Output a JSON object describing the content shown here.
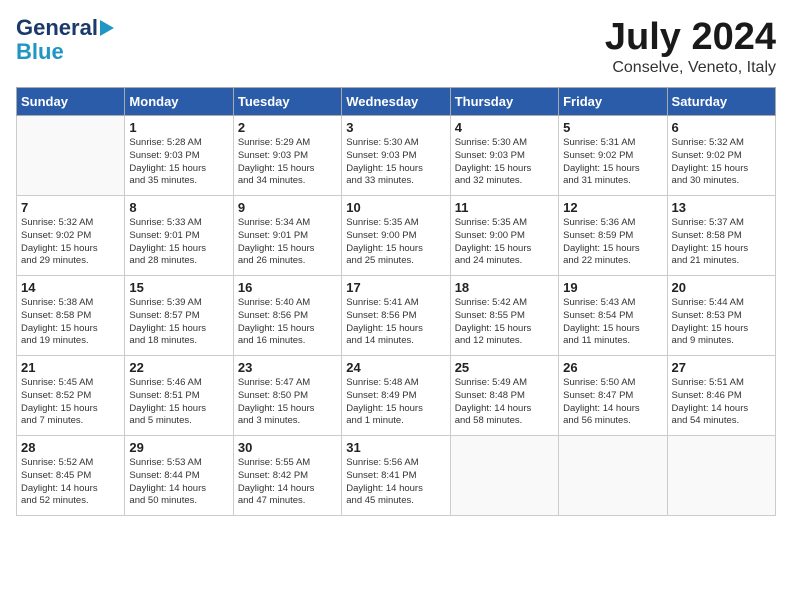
{
  "logo": {
    "line1": "General",
    "line2": "Blue"
  },
  "title": "July 2024",
  "subtitle": "Conselve, Veneto, Italy",
  "days": [
    "Sunday",
    "Monday",
    "Tuesday",
    "Wednesday",
    "Thursday",
    "Friday",
    "Saturday"
  ],
  "weeks": [
    [
      {
        "num": "",
        "info": ""
      },
      {
        "num": "1",
        "info": "Sunrise: 5:28 AM\nSunset: 9:03 PM\nDaylight: 15 hours\nand 35 minutes."
      },
      {
        "num": "2",
        "info": "Sunrise: 5:29 AM\nSunset: 9:03 PM\nDaylight: 15 hours\nand 34 minutes."
      },
      {
        "num": "3",
        "info": "Sunrise: 5:30 AM\nSunset: 9:03 PM\nDaylight: 15 hours\nand 33 minutes."
      },
      {
        "num": "4",
        "info": "Sunrise: 5:30 AM\nSunset: 9:03 PM\nDaylight: 15 hours\nand 32 minutes."
      },
      {
        "num": "5",
        "info": "Sunrise: 5:31 AM\nSunset: 9:02 PM\nDaylight: 15 hours\nand 31 minutes."
      },
      {
        "num": "6",
        "info": "Sunrise: 5:32 AM\nSunset: 9:02 PM\nDaylight: 15 hours\nand 30 minutes."
      }
    ],
    [
      {
        "num": "7",
        "info": "Sunrise: 5:32 AM\nSunset: 9:02 PM\nDaylight: 15 hours\nand 29 minutes."
      },
      {
        "num": "8",
        "info": "Sunrise: 5:33 AM\nSunset: 9:01 PM\nDaylight: 15 hours\nand 28 minutes."
      },
      {
        "num": "9",
        "info": "Sunrise: 5:34 AM\nSunset: 9:01 PM\nDaylight: 15 hours\nand 26 minutes."
      },
      {
        "num": "10",
        "info": "Sunrise: 5:35 AM\nSunset: 9:00 PM\nDaylight: 15 hours\nand 25 minutes."
      },
      {
        "num": "11",
        "info": "Sunrise: 5:35 AM\nSunset: 9:00 PM\nDaylight: 15 hours\nand 24 minutes."
      },
      {
        "num": "12",
        "info": "Sunrise: 5:36 AM\nSunset: 8:59 PM\nDaylight: 15 hours\nand 22 minutes."
      },
      {
        "num": "13",
        "info": "Sunrise: 5:37 AM\nSunset: 8:58 PM\nDaylight: 15 hours\nand 21 minutes."
      }
    ],
    [
      {
        "num": "14",
        "info": "Sunrise: 5:38 AM\nSunset: 8:58 PM\nDaylight: 15 hours\nand 19 minutes."
      },
      {
        "num": "15",
        "info": "Sunrise: 5:39 AM\nSunset: 8:57 PM\nDaylight: 15 hours\nand 18 minutes."
      },
      {
        "num": "16",
        "info": "Sunrise: 5:40 AM\nSunset: 8:56 PM\nDaylight: 15 hours\nand 16 minutes."
      },
      {
        "num": "17",
        "info": "Sunrise: 5:41 AM\nSunset: 8:56 PM\nDaylight: 15 hours\nand 14 minutes."
      },
      {
        "num": "18",
        "info": "Sunrise: 5:42 AM\nSunset: 8:55 PM\nDaylight: 15 hours\nand 12 minutes."
      },
      {
        "num": "19",
        "info": "Sunrise: 5:43 AM\nSunset: 8:54 PM\nDaylight: 15 hours\nand 11 minutes."
      },
      {
        "num": "20",
        "info": "Sunrise: 5:44 AM\nSunset: 8:53 PM\nDaylight: 15 hours\nand 9 minutes."
      }
    ],
    [
      {
        "num": "21",
        "info": "Sunrise: 5:45 AM\nSunset: 8:52 PM\nDaylight: 15 hours\nand 7 minutes."
      },
      {
        "num": "22",
        "info": "Sunrise: 5:46 AM\nSunset: 8:51 PM\nDaylight: 15 hours\nand 5 minutes."
      },
      {
        "num": "23",
        "info": "Sunrise: 5:47 AM\nSunset: 8:50 PM\nDaylight: 15 hours\nand 3 minutes."
      },
      {
        "num": "24",
        "info": "Sunrise: 5:48 AM\nSunset: 8:49 PM\nDaylight: 15 hours\nand 1 minute."
      },
      {
        "num": "25",
        "info": "Sunrise: 5:49 AM\nSunset: 8:48 PM\nDaylight: 14 hours\nand 58 minutes."
      },
      {
        "num": "26",
        "info": "Sunrise: 5:50 AM\nSunset: 8:47 PM\nDaylight: 14 hours\nand 56 minutes."
      },
      {
        "num": "27",
        "info": "Sunrise: 5:51 AM\nSunset: 8:46 PM\nDaylight: 14 hours\nand 54 minutes."
      }
    ],
    [
      {
        "num": "28",
        "info": "Sunrise: 5:52 AM\nSunset: 8:45 PM\nDaylight: 14 hours\nand 52 minutes."
      },
      {
        "num": "29",
        "info": "Sunrise: 5:53 AM\nSunset: 8:44 PM\nDaylight: 14 hours\nand 50 minutes."
      },
      {
        "num": "30",
        "info": "Sunrise: 5:55 AM\nSunset: 8:42 PM\nDaylight: 14 hours\nand 47 minutes."
      },
      {
        "num": "31",
        "info": "Sunrise: 5:56 AM\nSunset: 8:41 PM\nDaylight: 14 hours\nand 45 minutes."
      },
      {
        "num": "",
        "info": ""
      },
      {
        "num": "",
        "info": ""
      },
      {
        "num": "",
        "info": ""
      }
    ]
  ]
}
